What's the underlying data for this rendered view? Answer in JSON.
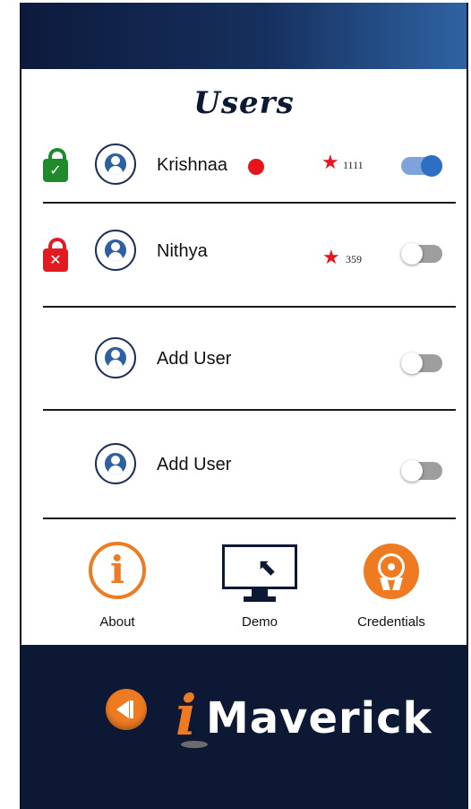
{
  "screen": {
    "title": "Users"
  },
  "users": [
    {
      "name": "Krishnaa",
      "lock": "unlocked",
      "status_dot": true,
      "star": "★",
      "score": "1111",
      "toggle_on": true
    },
    {
      "name": "Nithya",
      "lock": "locked",
      "status_dot": false,
      "star": "★",
      "score": "359",
      "toggle_on": false
    },
    {
      "name": "Add User",
      "lock": "none",
      "status_dot": false,
      "star": "",
      "score": "",
      "toggle_on": false
    },
    {
      "name": "Add User",
      "lock": "none",
      "status_dot": false,
      "star": "",
      "score": "",
      "toggle_on": false
    }
  ],
  "nav": {
    "about": {
      "label": "About",
      "icon": "info-icon"
    },
    "demo": {
      "label": "Demo",
      "icon": "monitor-cursor-icon"
    },
    "credentials": {
      "label": "Credentials",
      "icon": "award-badge-icon"
    }
  },
  "footer": {
    "brand_i": "i",
    "brand_name": "Maverick",
    "back_icon": "back-arrow-icon"
  },
  "colors": {
    "accent_orange": "#ee7b22",
    "navy": "#0c1834",
    "star_red": "#e8141c",
    "lock_green": "#1f8a2c",
    "lock_red": "#e21b23",
    "toggle_blue": "#2d6fc2"
  }
}
